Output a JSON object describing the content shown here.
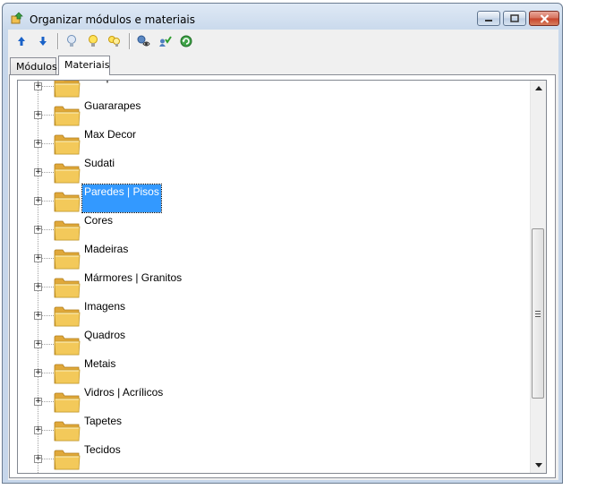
{
  "window": {
    "title": "Organizar módulos e materiais"
  },
  "toolbar": {
    "buttons": [
      {
        "icon": "arrow-up-icon"
      },
      {
        "icon": "arrow-down-icon"
      },
      {
        "icon": "lightbulb-off-icon"
      },
      {
        "icon": "lightbulb-on-icon"
      },
      {
        "icon": "lightbulbs-icon"
      },
      {
        "icon": "view-eye-icon"
      },
      {
        "icon": "user-check-icon"
      },
      {
        "icon": "refresh-icon"
      }
    ]
  },
  "tabs": [
    {
      "label": "Módulos",
      "active": false
    },
    {
      "label": "Materiais",
      "active": true
    }
  ],
  "tree": {
    "items": [
      {
        "label": "Braspan"
      },
      {
        "label": "Guararapes"
      },
      {
        "label": "Max Decor"
      },
      {
        "label": "Sudati"
      },
      {
        "label": "Paredes | Pisos",
        "selected": true
      },
      {
        "label": "Cores"
      },
      {
        "label": "Madeiras"
      },
      {
        "label": "Mármores | Granitos"
      },
      {
        "label": "Imagens"
      },
      {
        "label": "Quadros"
      },
      {
        "label": "Metais"
      },
      {
        "label": "Vidros | Acrílicos"
      },
      {
        "label": "Tapetes"
      },
      {
        "label": "Tecidos"
      }
    ],
    "expander_symbol": "+"
  },
  "colors": {
    "selection": "#3399ff",
    "folder": "#f3c95a"
  }
}
